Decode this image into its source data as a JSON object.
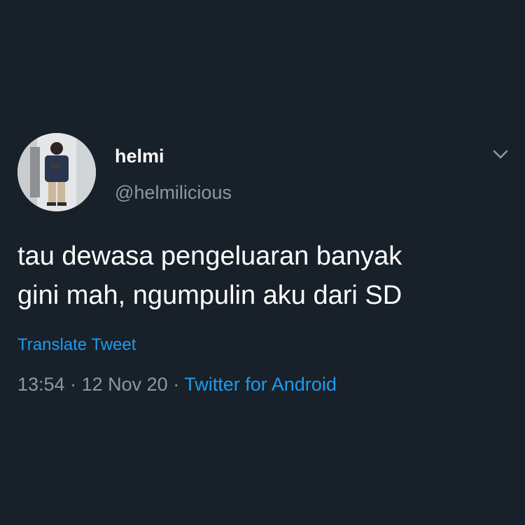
{
  "tweet": {
    "display_name": "helmi",
    "handle": "@helmilicious",
    "text": "tau dewasa pengeluaran banyak\ngini mah, ngumpulin aku dari SD",
    "translate_label": "Translate Tweet",
    "time": "13:54",
    "separator": "·",
    "date": "12 Nov 20",
    "source": "Twitter for Android"
  },
  "icons": {
    "more": "chevron-down-icon"
  },
  "colors": {
    "background": "#182029",
    "primary_text": "#ffffff",
    "secondary_text": "#8b98a5",
    "link": "#1d9bf0"
  }
}
